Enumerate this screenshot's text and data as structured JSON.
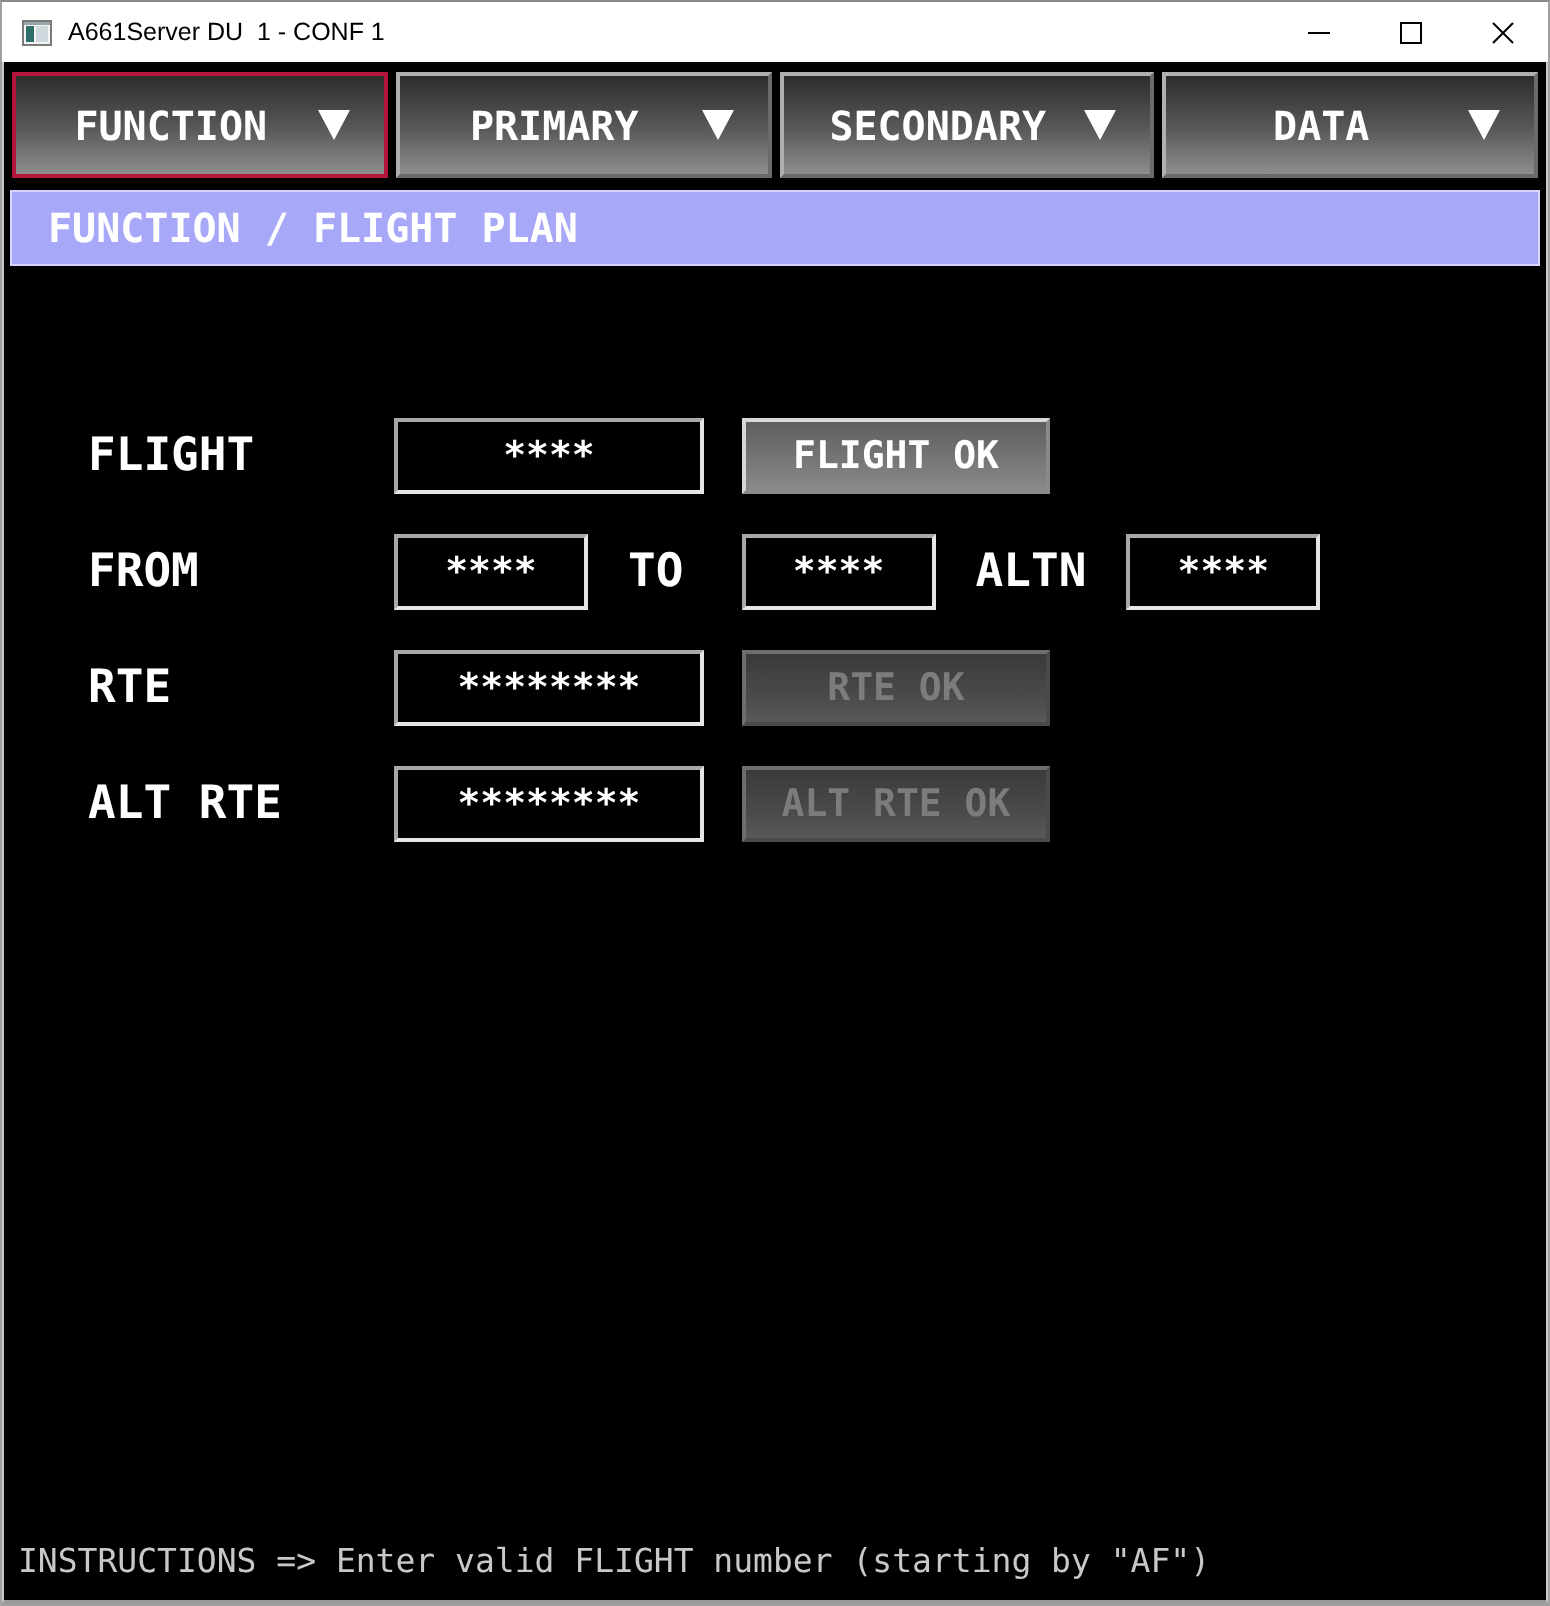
{
  "window": {
    "title": "A661Server DU  1 - CONF 1"
  },
  "menu": [
    {
      "label": "FUNCTION",
      "selected": true
    },
    {
      "label": "PRIMARY",
      "selected": false
    },
    {
      "label": "SECONDARY",
      "selected": false
    },
    {
      "label": "DATA",
      "selected": false
    }
  ],
  "banner": {
    "text": "FUNCTION / FLIGHT PLAN"
  },
  "form": {
    "rows": [
      {
        "label": "FLIGHT",
        "items": [
          {
            "kind": "field",
            "value": "****"
          },
          {
            "kind": "button",
            "label": "FLIGHT OK",
            "disabled": false
          }
        ]
      },
      {
        "label": "FROM",
        "items": [
          {
            "kind": "field",
            "value": "****"
          },
          {
            "kind": "label",
            "text": "TO"
          },
          {
            "kind": "field",
            "value": "****"
          },
          {
            "kind": "label",
            "text": "ALTN"
          },
          {
            "kind": "field",
            "value": "****"
          }
        ]
      },
      {
        "label": "RTE",
        "items": [
          {
            "kind": "field",
            "value": "********"
          },
          {
            "kind": "button",
            "label": "RTE OK",
            "disabled": true
          }
        ]
      },
      {
        "label": "ALT RTE",
        "items": [
          {
            "kind": "field",
            "value": "********"
          },
          {
            "kind": "button",
            "label": "ALT RTE OK",
            "disabled": true
          }
        ]
      }
    ]
  },
  "instructions": {
    "text": "INSTRUCTIONS => Enter valid FLIGHT number (starting by \"AF\")"
  }
}
